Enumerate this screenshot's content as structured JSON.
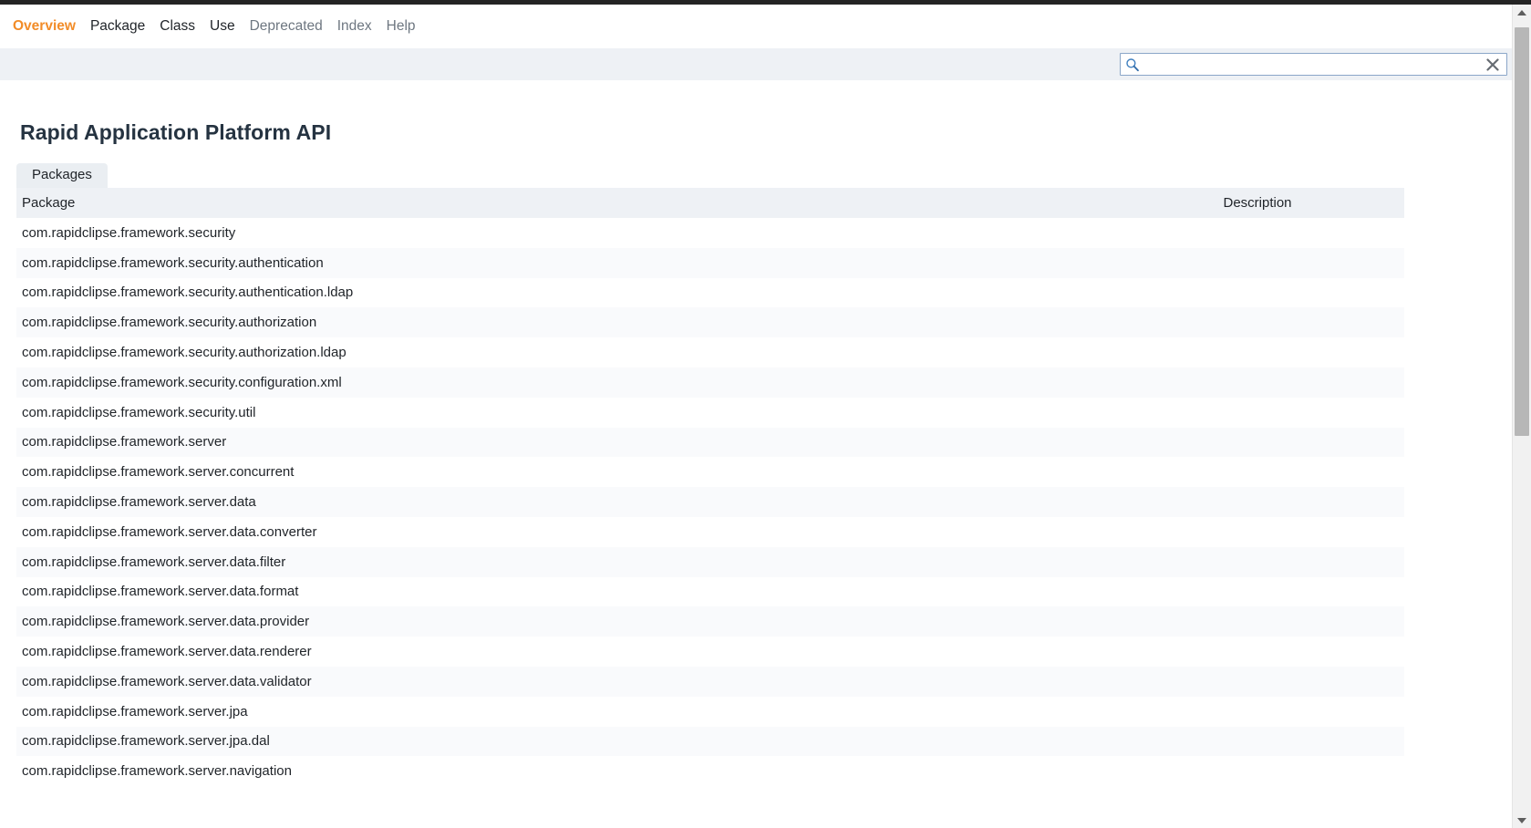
{
  "browser": {
    "top_bar_color": "#242424"
  },
  "nav": {
    "items": [
      {
        "label": "Overview",
        "state": "active"
      },
      {
        "label": "Package",
        "state": "normal"
      },
      {
        "label": "Class",
        "state": "normal"
      },
      {
        "label": "Use",
        "state": "normal"
      },
      {
        "label": "Deprecated",
        "state": "muted"
      },
      {
        "label": "Index",
        "state": "muted"
      },
      {
        "label": "Help",
        "state": "muted"
      }
    ],
    "active_color": "#f28c28",
    "normal_color": "#1f2328",
    "muted_color": "#6e7781"
  },
  "search": {
    "value": "",
    "placeholder": "",
    "icon": "search-icon",
    "clear_icon": "close-icon",
    "band_color": "#eef1f5"
  },
  "header": {
    "title": "Rapid Application Platform API"
  },
  "tabs": [
    {
      "label": "Packages",
      "selected": true
    }
  ],
  "table": {
    "columns": [
      "Package",
      "Description"
    ],
    "rows": [
      {
        "package": "com.rapidclipse.framework.security",
        "description": ""
      },
      {
        "package": "com.rapidclipse.framework.security.authentication",
        "description": ""
      },
      {
        "package": "com.rapidclipse.framework.security.authentication.ldap",
        "description": ""
      },
      {
        "package": "com.rapidclipse.framework.security.authorization",
        "description": ""
      },
      {
        "package": "com.rapidclipse.framework.security.authorization.ldap",
        "description": ""
      },
      {
        "package": "com.rapidclipse.framework.security.configuration.xml",
        "description": ""
      },
      {
        "package": "com.rapidclipse.framework.security.util",
        "description": ""
      },
      {
        "package": "com.rapidclipse.framework.server",
        "description": ""
      },
      {
        "package": "com.rapidclipse.framework.server.concurrent",
        "description": ""
      },
      {
        "package": "com.rapidclipse.framework.server.data",
        "description": ""
      },
      {
        "package": "com.rapidclipse.framework.server.data.converter",
        "description": ""
      },
      {
        "package": "com.rapidclipse.framework.server.data.filter",
        "description": ""
      },
      {
        "package": "com.rapidclipse.framework.server.data.format",
        "description": ""
      },
      {
        "package": "com.rapidclipse.framework.server.data.provider",
        "description": ""
      },
      {
        "package": "com.rapidclipse.framework.server.data.renderer",
        "description": ""
      },
      {
        "package": "com.rapidclipse.framework.server.data.validator",
        "description": ""
      },
      {
        "package": "com.rapidclipse.framework.server.jpa",
        "description": ""
      },
      {
        "package": "com.rapidclipse.framework.server.jpa.dal",
        "description": ""
      },
      {
        "package": "com.rapidclipse.framework.server.navigation",
        "description": ""
      }
    ],
    "header_bg": "#eef1f5",
    "row_bg_odd": "#ffffff",
    "row_bg_even": "#f9fafc"
  },
  "scrollbar": {
    "track_color": "#f1f1f1",
    "thumb_color": "#b7b7b7",
    "up_arrow": "triangle-up-icon",
    "down_arrow": "triangle-down-icon"
  }
}
